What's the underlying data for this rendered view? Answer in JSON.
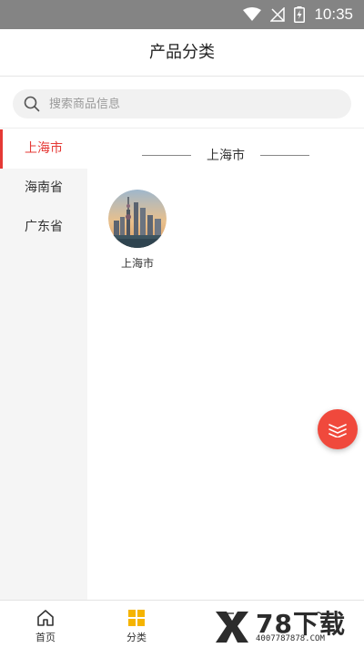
{
  "status_bar": {
    "time": "10:35",
    "icons": [
      "wifi-icon",
      "no-signal-icon",
      "battery-charging-icon"
    ]
  },
  "header": {
    "title": "产品分类"
  },
  "search": {
    "placeholder": "搜索商品信息",
    "icon": "search-icon"
  },
  "sidebar": {
    "items": [
      {
        "label": "上海市",
        "active": true
      },
      {
        "label": "海南省",
        "active": false
      },
      {
        "label": "广东省",
        "active": false
      }
    ]
  },
  "content": {
    "section_title": "上海市",
    "cities": [
      {
        "name": "上海市",
        "image": "shanghai-skyline-image"
      }
    ]
  },
  "float_button": {
    "icon": "layers-icon",
    "color": "#f0493c"
  },
  "tabs": [
    {
      "label": "首页",
      "icon": "home-icon"
    },
    {
      "label": "分类",
      "icon": "category-grid-icon",
      "active": true
    },
    {
      "label": "",
      "icon": "cart-icon"
    },
    {
      "label": "",
      "icon": "user-icon"
    }
  ],
  "watermark": {
    "brand": "78下载",
    "url": "4007787878.COM"
  },
  "colors": {
    "accent": "#e53935",
    "category_active": "#f5b400",
    "status_bar": "#848484"
  }
}
